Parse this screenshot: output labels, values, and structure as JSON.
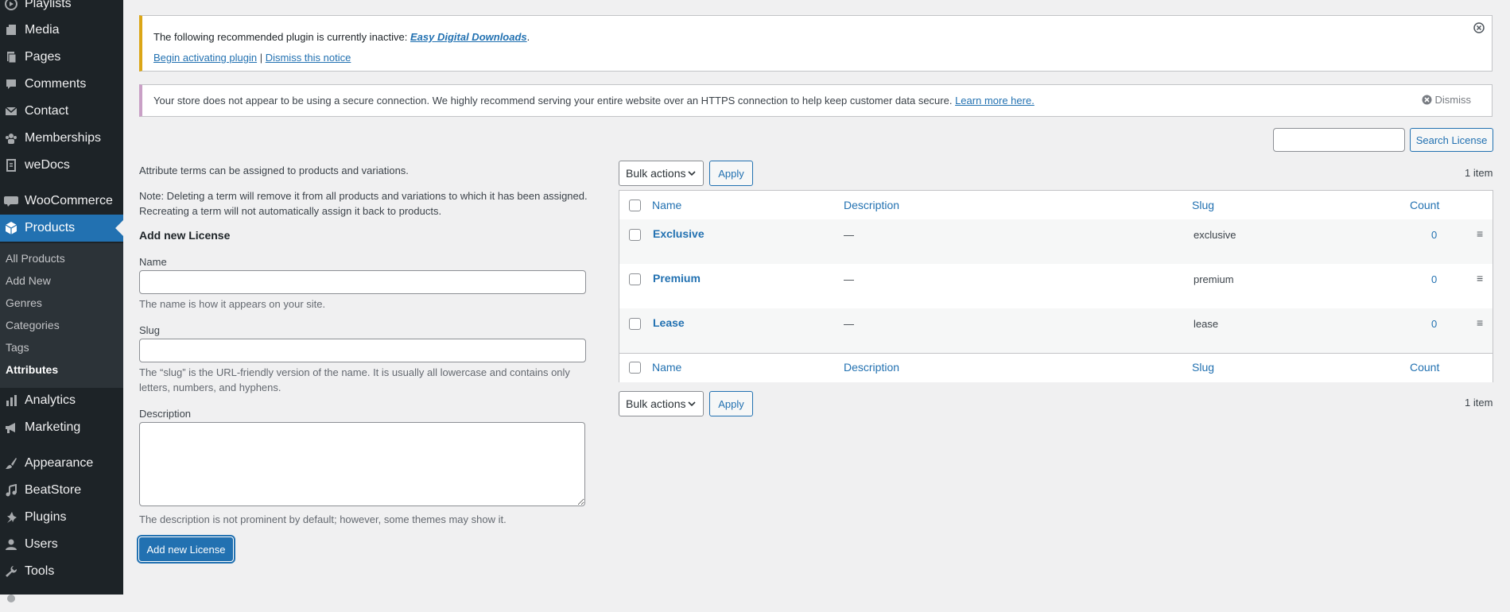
{
  "sidebar": {
    "items": [
      {
        "label": "Playlists",
        "icon": "playlist-icon"
      },
      {
        "label": "Media",
        "icon": "media-icon"
      },
      {
        "label": "Pages",
        "icon": "pages-icon"
      },
      {
        "label": "Comments",
        "icon": "comments-icon"
      },
      {
        "label": "Contact",
        "icon": "mail-icon"
      },
      {
        "label": "Memberships",
        "icon": "groups-icon"
      },
      {
        "label": "weDocs",
        "icon": "document-icon"
      },
      {
        "label": "WooCommerce",
        "icon": "woocommerce-icon"
      },
      {
        "label": "Products",
        "icon": "products-icon"
      },
      {
        "label": "Analytics",
        "icon": "analytics-icon"
      },
      {
        "label": "Marketing",
        "icon": "megaphone-icon"
      },
      {
        "label": "Appearance",
        "icon": "paintbrush-icon"
      },
      {
        "label": "BeatStore",
        "icon": "music-icon"
      },
      {
        "label": "Plugins",
        "icon": "plugin-icon"
      },
      {
        "label": "Users",
        "icon": "user-icon"
      },
      {
        "label": "Tools",
        "icon": "wrench-icon"
      }
    ],
    "submenu": [
      "All Products",
      "Add New",
      "Genres",
      "Categories",
      "Tags",
      "Attributes"
    ]
  },
  "notice_plugin": {
    "text": "The following recommended plugin is currently inactive: ",
    "plugin_link": "Easy Digital Downloads",
    "period": ".",
    "activate": "Begin activating plugin",
    "separator": " | ",
    "dismiss": "Dismiss this notice"
  },
  "notice_ssl": {
    "text": "Your store does not appear to be using a secure connection. We highly recommend serving your entire website over an HTTPS connection to help keep customer data secure. ",
    "learn_more": "Learn more here.",
    "dismiss": "Dismiss"
  },
  "search": {
    "value": "",
    "button": "Search License"
  },
  "form": {
    "intro": "Attribute terms can be assigned to products and variations.",
    "note_line1": "Note: Deleting a term will remove it from all products and variations to which it has been assigned.",
    "note_line2": "Recreating a term will not automatically assign it back to products.",
    "heading": "Add new License",
    "name_label": "Name",
    "name_help": "The name is how it appears on your site.",
    "slug_label": "Slug",
    "slug_help_line1": "The “slug” is the URL-friendly version of the name. It is usually all lowercase and contains only",
    "slug_help_line2": "letters, numbers, and hyphens.",
    "description_label": "Description",
    "description_help": "The description is not prominent by default; however, some themes may show it.",
    "submit": "Add new License"
  },
  "table": {
    "bulk_actions": "Bulk actions",
    "apply": "Apply",
    "item_count": "1 item",
    "columns": {
      "name": "Name",
      "description": "Description",
      "slug": "Slug",
      "count": "Count"
    },
    "rows": [
      {
        "name": "Exclusive",
        "description": "—",
        "slug": "exclusive",
        "count": "0"
      },
      {
        "name": "Premium",
        "description": "—",
        "slug": "premium",
        "count": "0"
      },
      {
        "name": "Lease",
        "description": "—",
        "slug": "lease",
        "count": "0"
      }
    ]
  }
}
